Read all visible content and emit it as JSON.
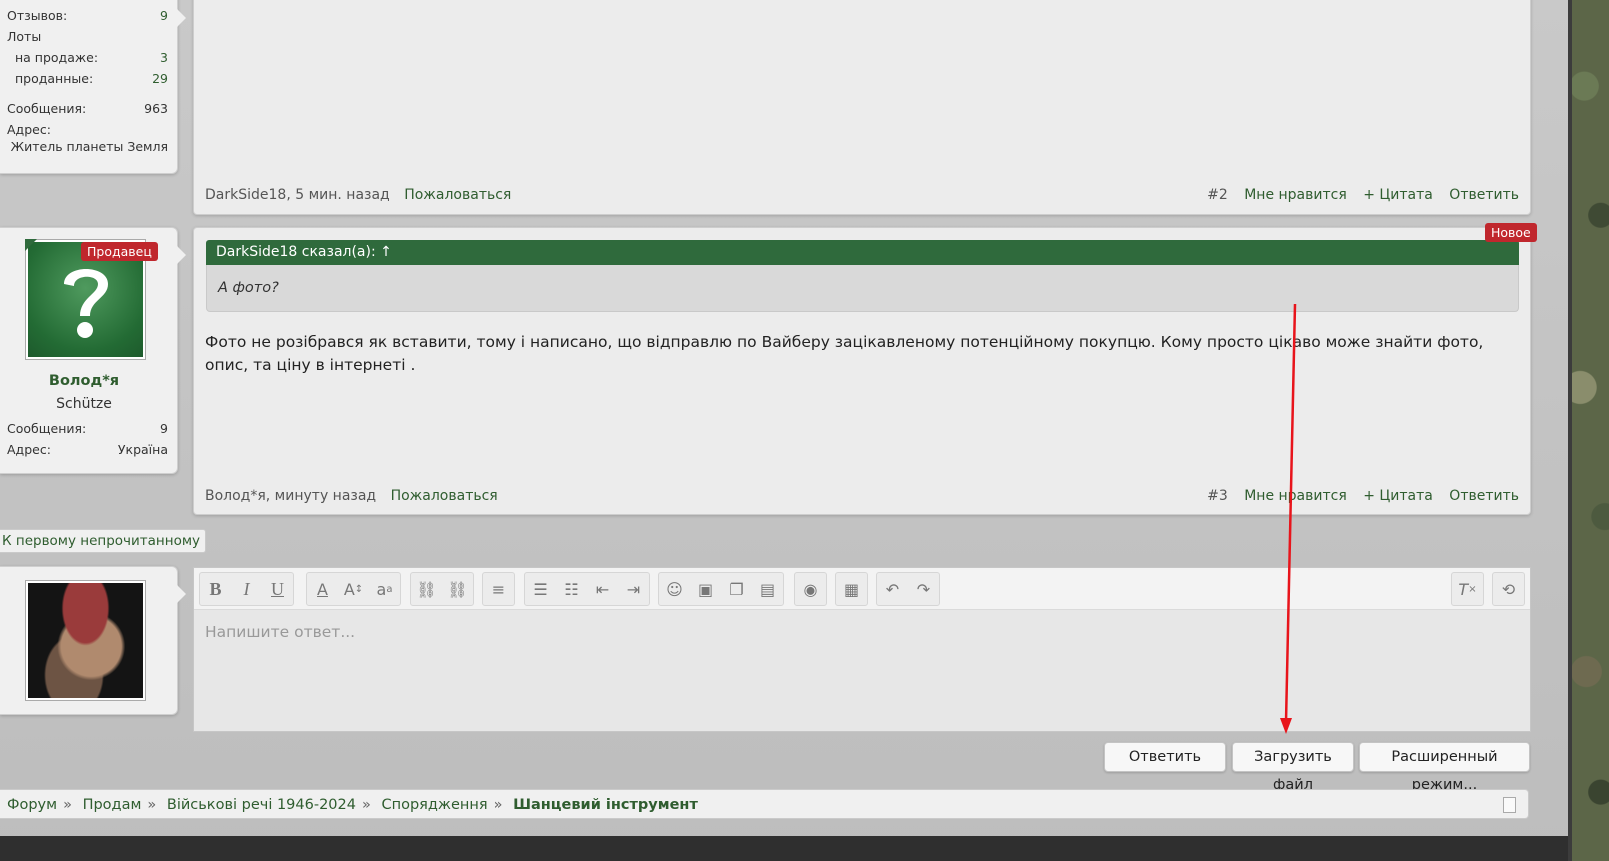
{
  "top_user": {
    "reviews_label": "Отзывов:",
    "reviews_value": "9",
    "lots_label": "Лоты",
    "on_sale_label": "на продаже:",
    "on_sale_value": "3",
    "sold_label": "проданные:",
    "sold_value": "29",
    "messages_label": "Сообщения:",
    "messages_value": "963",
    "address_label": "Адрес:",
    "address_value": "Житель планеты Земля"
  },
  "post2": {
    "author_time": "DarkSide18, 5 мин. назад",
    "report": "Пожаловаться",
    "number": "#2",
    "like": "Мне нравится",
    "quote": "+ Цитата",
    "reply": "Ответить"
  },
  "user3": {
    "badge": "Продавец",
    "name": "Волод*я",
    "title": "Schütze",
    "messages_label": "Сообщения:",
    "messages_value": "9",
    "address_label": "Адрес:",
    "address_value": "Україна"
  },
  "post3": {
    "new_badge": "Новое",
    "quote_head": "DarkSide18 сказал(а): ↑",
    "quote_text": "А фото?",
    "body": "Фото не розібрався як вставити, тому і написано, що відправлю по Вайберу зацікавленому потенційному покупцю. Кому просто цікаво може знайти фото, опис, та ціну в інтернеті .",
    "author_time": "Волод*я, минуту назад",
    "report": "Пожаловаться",
    "number": "#3",
    "like": "Мне нравится",
    "quote": "+ Цитата",
    "reply": "Ответить"
  },
  "first_unread": "К первому непрочитанному",
  "editor": {
    "placeholder": "Напишите ответ..."
  },
  "buttons": {
    "reply": "Ответить",
    "upload": "Загрузить файл",
    "advanced": "Расширенный режим..."
  },
  "breadcrumb": [
    "Форум",
    "Продам",
    "Військові речі 1946-2024",
    "Спорядження",
    "Шанцевий інструмент"
  ],
  "colors": {
    "accent": "#2f5d2f",
    "badge": "#c0272d",
    "arrow": "#e8141b"
  }
}
